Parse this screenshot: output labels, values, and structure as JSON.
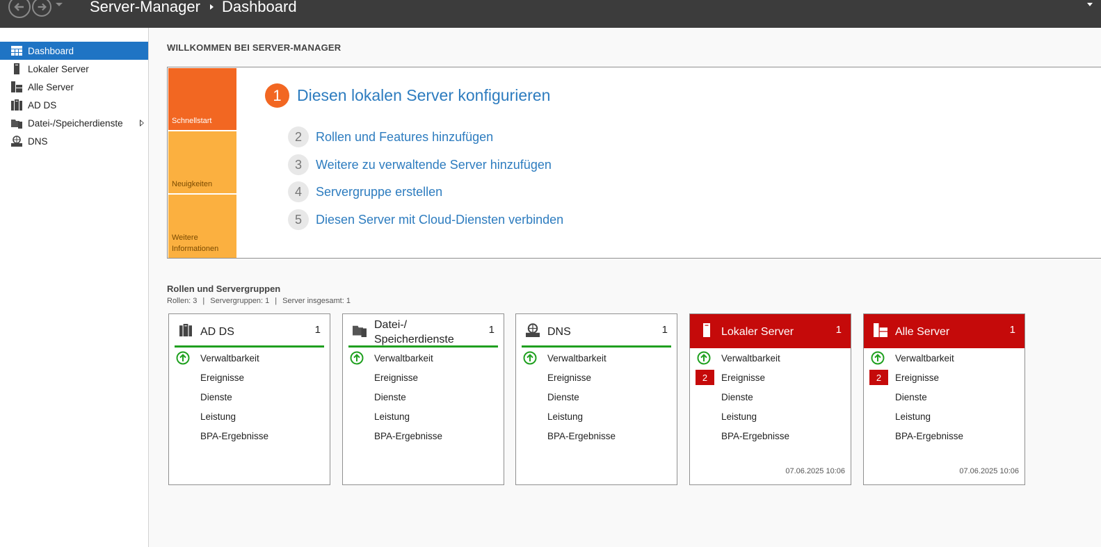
{
  "titlebar": {
    "breadcrumb": [
      "Server-Manager",
      "Dashboard"
    ],
    "icons": [
      "back-arrow-icon",
      "forward-arrow-icon",
      "dropdown-icon"
    ]
  },
  "sidebar": {
    "items": [
      {
        "label": "Dashboard",
        "icon": "dashboard-icon",
        "active": true
      },
      {
        "label": "Lokaler Server",
        "icon": "server-icon"
      },
      {
        "label": "Alle Server",
        "icon": "all-servers-icon"
      },
      {
        "label": "AD DS",
        "icon": "adds-icon"
      },
      {
        "label": "Datei-/Speicherdienste",
        "icon": "file-storage-icon",
        "expandable": true
      },
      {
        "label": "DNS",
        "icon": "dns-icon"
      }
    ]
  },
  "welcome": {
    "title": "WILLKOMMEN BEI SERVER-MANAGER",
    "tabs": [
      "Schnellstart",
      "Neuigkeiten",
      "Weitere Informationen"
    ],
    "steps": [
      {
        "num": "1",
        "text": "Diesen lokalen Server konfigurieren"
      },
      {
        "num": "2",
        "text": "Rollen und Features hinzufügen"
      },
      {
        "num": "3",
        "text": "Weitere zu verwaltende Server hinzufügen"
      },
      {
        "num": "4",
        "text": "Servergruppe erstellen"
      },
      {
        "num": "5",
        "text": "Diesen Server mit Cloud-Diensten verbinden"
      }
    ]
  },
  "roles": {
    "title": "Rollen und Servergruppen",
    "summary": [
      "Rollen: 3",
      "Servergruppen: 1",
      "Server insgesamt: 1"
    ],
    "tiles": [
      {
        "title": "AD DS",
        "count": "1",
        "status": "ok",
        "icon": "adds-icon",
        "rows": [
          "Verwaltbarkeit",
          "Ereignisse",
          "Dienste",
          "Leistung",
          "BPA-Ergebnisse"
        ],
        "badge": "",
        "timestamp": ""
      },
      {
        "title": "Datei-/ Speicherdienste",
        "title_lines": [
          "Datei-/",
          "Speicherdienste"
        ],
        "count": "1",
        "status": "ok",
        "icon": "file-storage-icon",
        "rows": [
          "Verwaltbarkeit",
          "Ereignisse",
          "Dienste",
          "Leistung",
          "BPA-Ergebnisse"
        ],
        "badge": "",
        "timestamp": ""
      },
      {
        "title": "DNS",
        "count": "1",
        "status": "ok",
        "icon": "dns-icon",
        "rows": [
          "Verwaltbarkeit",
          "Ereignisse",
          "Dienste",
          "Leistung",
          "BPA-Ergebnisse"
        ],
        "badge": "",
        "timestamp": ""
      },
      {
        "title": "Lokaler Server",
        "count": "1",
        "status": "alert",
        "icon": "server-icon",
        "rows": [
          "Verwaltbarkeit",
          "Ereignisse",
          "Dienste",
          "Leistung",
          "BPA-Ergebnisse"
        ],
        "badge": "2",
        "timestamp": "07.06.2025 10:06"
      },
      {
        "title": "Alle Server",
        "count": "1",
        "status": "alert",
        "icon": "all-servers-icon",
        "rows": [
          "Verwaltbarkeit",
          "Ereignisse",
          "Dienste",
          "Leistung",
          "BPA-Ergebnisse"
        ],
        "badge": "2",
        "timestamp": "07.06.2025 10:06"
      }
    ]
  },
  "colors": {
    "titlebar": "#3c3c3c",
    "accent_blue": "#1f74c4",
    "link": "#2d7cbf",
    "quickstart_orange": "#f26722",
    "tab_amber": "#fbb040",
    "ok_green": "#1fa01f",
    "alert_red": "#c50a0a"
  }
}
